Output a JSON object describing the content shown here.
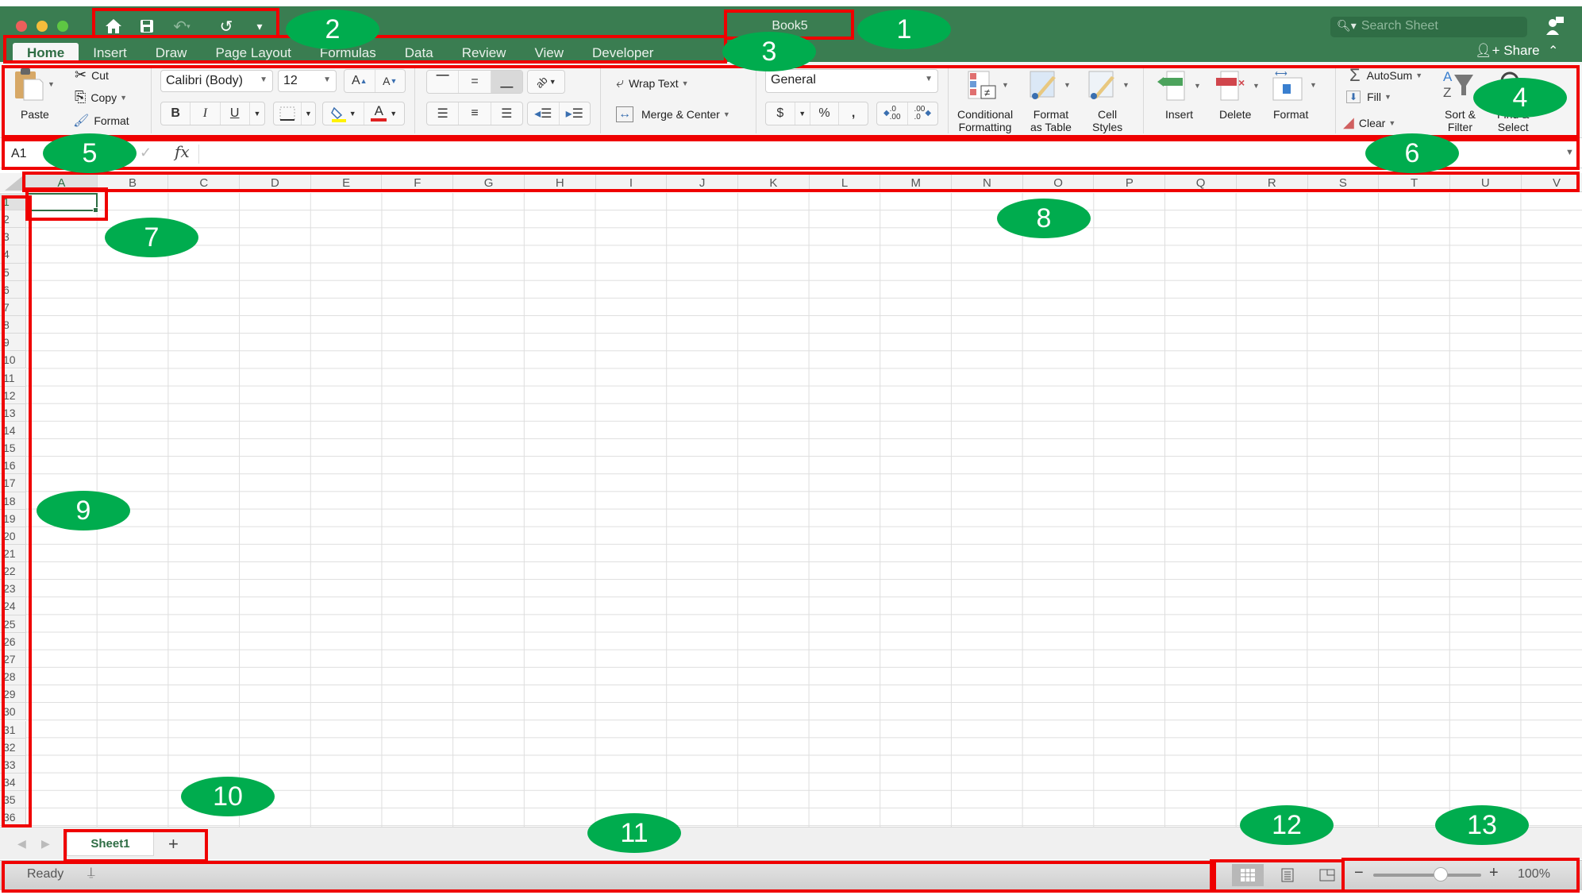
{
  "window": {
    "title": "Book5",
    "search_placeholder": "Search Sheet",
    "share_label": "Share",
    "quick_access": [
      "home-icon",
      "save-icon",
      "undo-icon",
      "redo-icon",
      "customize-icon"
    ]
  },
  "tabs": [
    {
      "label": "Home",
      "active": true
    },
    {
      "label": "Insert"
    },
    {
      "label": "Draw"
    },
    {
      "label": "Page Layout"
    },
    {
      "label": "Formulas"
    },
    {
      "label": "Data"
    },
    {
      "label": "Review"
    },
    {
      "label": "View"
    },
    {
      "label": "Developer"
    }
  ],
  "ribbon": {
    "clipboard": {
      "paste": "Paste",
      "cut": "Cut",
      "copy": "Copy",
      "format": "Format"
    },
    "font": {
      "name": "Calibri (Body)",
      "size": "12",
      "grow": "A",
      "shrink": "A",
      "bold": "B",
      "italic": "I",
      "underline": "U",
      "font_color": "A"
    },
    "alignment": {
      "wrap_text": "Wrap Text",
      "merge_center": "Merge & Center"
    },
    "number": {
      "format": "General",
      "currency": "$",
      "percent": "%",
      "comma": ",",
      "inc_decimal": ".0\n.00",
      "dec_decimal": ".00\n.0"
    },
    "styles": {
      "conditional": "Conditional\nFormatting",
      "format_table": "Format\nas Table",
      "cell_styles": "Cell\nStyles"
    },
    "cells": {
      "insert": "Insert",
      "delete": "Delete",
      "format": "Format"
    },
    "editing": {
      "autosum": "AutoSum",
      "fill": "Fill",
      "clear": "Clear",
      "sort_filter": "Sort &\nFilter",
      "find_select": "Find &\nSelect"
    }
  },
  "formula_bar": {
    "name_box": "A1",
    "fx": "fx",
    "value": ""
  },
  "grid": {
    "columns": [
      "A",
      "B",
      "C",
      "D",
      "E",
      "F",
      "G",
      "H",
      "I",
      "J",
      "K",
      "L",
      "M",
      "N",
      "O",
      "P",
      "Q",
      "R",
      "S",
      "T",
      "U",
      "V"
    ],
    "row_count": 36,
    "selected_cell": "A1"
  },
  "sheets": {
    "tabs": [
      "Sheet1"
    ],
    "active": "Sheet1",
    "add_label": "+"
  },
  "status": {
    "text": "Ready",
    "zoom": "100%",
    "zoom_value_percent": 100,
    "views": [
      "normal",
      "page-layout",
      "page-break"
    ]
  },
  "annotations": [
    "1",
    "2",
    "3",
    "4",
    "5",
    "6",
    "7",
    "8",
    "9",
    "10",
    "11",
    "12",
    "13"
  ],
  "colors": {
    "brand_green": "#3a7d51",
    "annotation_red": "#ef0000",
    "annotation_oval": "#00ac4e"
  }
}
